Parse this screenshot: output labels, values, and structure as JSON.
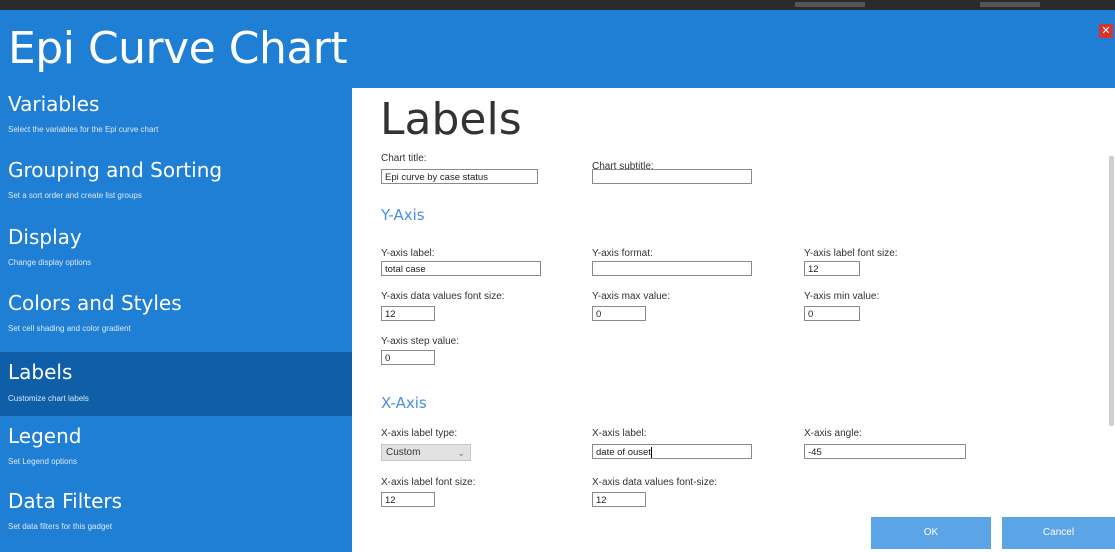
{
  "window": {
    "title": "Epi Curve Chart",
    "close_glyph": "✕"
  },
  "sidebar": {
    "items": [
      {
        "title": "Variables",
        "subtitle": "Select the variables for the Epi curve chart"
      },
      {
        "title": "Grouping and Sorting",
        "subtitle": "Set a sort order and create list groups"
      },
      {
        "title": "Display",
        "subtitle": "Change display options"
      },
      {
        "title": "Colors and Styles",
        "subtitle": "Set cell shading and color gradient"
      },
      {
        "title": "Labels",
        "subtitle": "Customize chart labels"
      },
      {
        "title": "Legend",
        "subtitle": "Set Legend options"
      },
      {
        "title": "Data Filters",
        "subtitle": "Set data filters for this gadget"
      }
    ],
    "active": "Labels"
  },
  "main": {
    "heading": "Labels",
    "chart_title": {
      "label": "Chart title:",
      "value": "Epi curve by case status"
    },
    "chart_subtitle": {
      "label": "Chart subtitle:",
      "value": ""
    },
    "y_axis": {
      "heading": "Y-Axis",
      "label": {
        "label": "Y-axis label:",
        "value": "total case"
      },
      "format": {
        "label": "Y-axis format:",
        "value": ""
      },
      "label_font_size": {
        "label": "Y-axis label font size:",
        "value": "12"
      },
      "data_values_font_size": {
        "label": "Y-axis data values font size:",
        "value": "12"
      },
      "max_value": {
        "label": "Y-axis max value:",
        "value": "0"
      },
      "min_value": {
        "label": "Y-axis min value:",
        "value": "0"
      },
      "step_value": {
        "label": "Y-axis step value:",
        "value": "0"
      }
    },
    "x_axis": {
      "heading": "X-Axis",
      "label_type": {
        "label": "X-axis label type:",
        "value": "Custom"
      },
      "label": {
        "label": "X-axis label:",
        "value": "date of ouset"
      },
      "angle": {
        "label": "X-axis angle:",
        "value": "-45"
      },
      "label_font_size": {
        "label": "X-axis label font size:",
        "value": "12"
      },
      "data_values_font_size": {
        "label": "X-axis data values font-size:",
        "value": "12"
      }
    }
  },
  "buttons": {
    "ok": "OK",
    "cancel": "Cancel"
  },
  "colors": {
    "header": "#1f7fd4",
    "active_nav": "#0e5fa8",
    "accent_heading": "#4a90d9",
    "button": "#5ba4e6",
    "close": "#d9342b"
  },
  "icons": {
    "close": "close-icon",
    "dropdown": "chevron-down-icon"
  }
}
